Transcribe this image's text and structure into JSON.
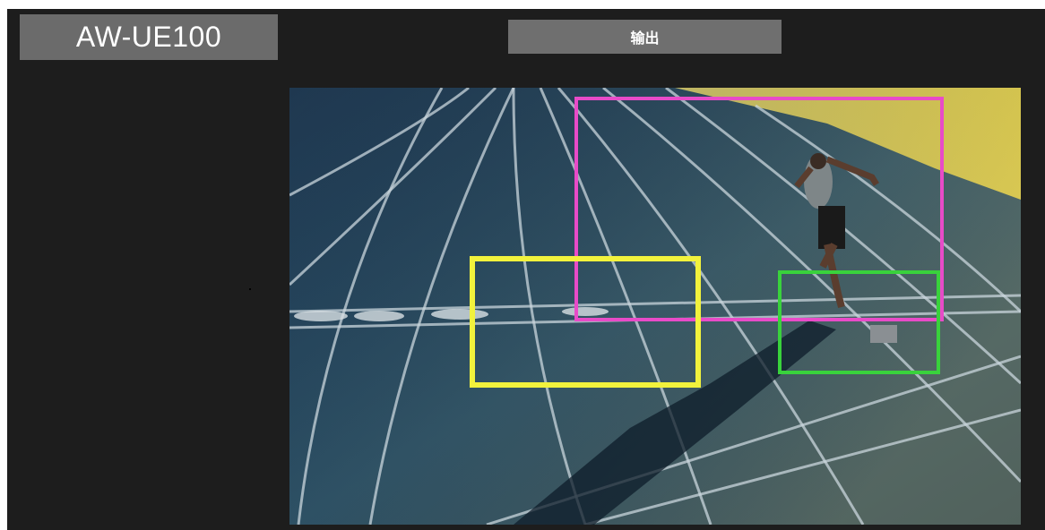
{
  "header": {
    "model_name": "AW-UE100",
    "output_button_label": "输出"
  },
  "preview": {
    "content": "running-track-sprinter",
    "regions": [
      {
        "name": "pink-region",
        "color": "#e84bc8"
      },
      {
        "name": "yellow-region",
        "color": "#f2f23c"
      },
      {
        "name": "green-region",
        "color": "#39d23c"
      }
    ]
  },
  "colors": {
    "background": "#1d1d1d",
    "panel": "#6b6b6b"
  }
}
